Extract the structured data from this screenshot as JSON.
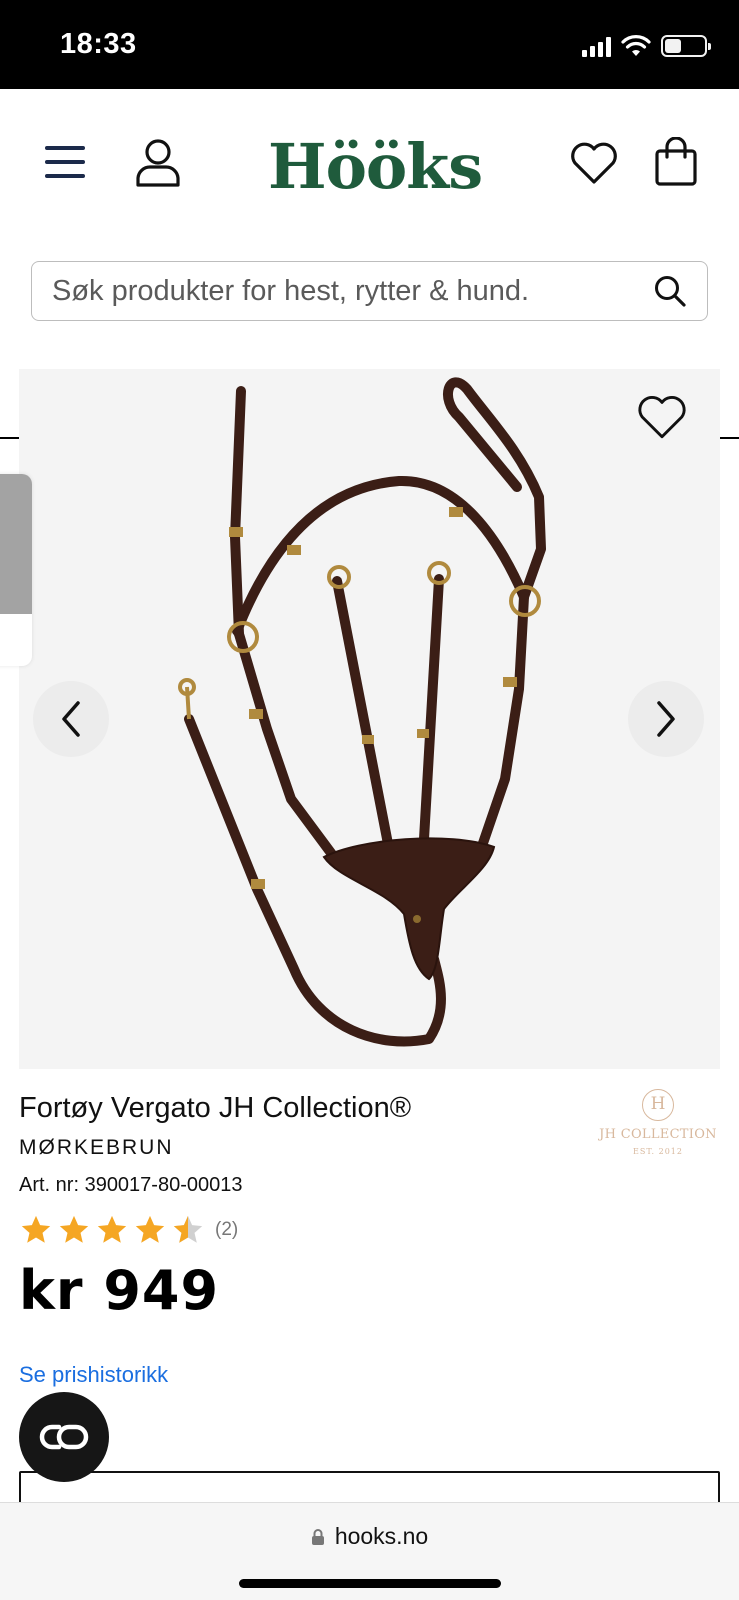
{
  "status_bar": {
    "time": "18:33"
  },
  "header": {
    "logo": "Hööks",
    "search_placeholder": "Søk produkter for hest, rytter & hund."
  },
  "product": {
    "title": "Fortøy Vergato JH Collection®",
    "color": "MØRKEBRUN",
    "art_nr": "Art. nr: 390017-80-00013",
    "rating": 4.5,
    "rating_count": "(2)",
    "price": "kr 949",
    "brand": {
      "monogram": "H",
      "name": "JH COLLECTION",
      "est": "EST. 2012"
    }
  },
  "links": {
    "history": "Se prishistorikk"
  },
  "browser": {
    "url": "hooks.no"
  },
  "colors": {
    "brand_green": "#1f5b3c",
    "link_blue": "#1a6ee0",
    "star_gold": "#f5a623",
    "leather_brown": "#3b1e16"
  },
  "icons": [
    "menu-icon",
    "account-icon",
    "heart-icon",
    "bag-icon",
    "search-icon",
    "chevron-left-icon",
    "chevron-right-icon",
    "star-icon",
    "chat-icon",
    "lock-icon"
  ]
}
